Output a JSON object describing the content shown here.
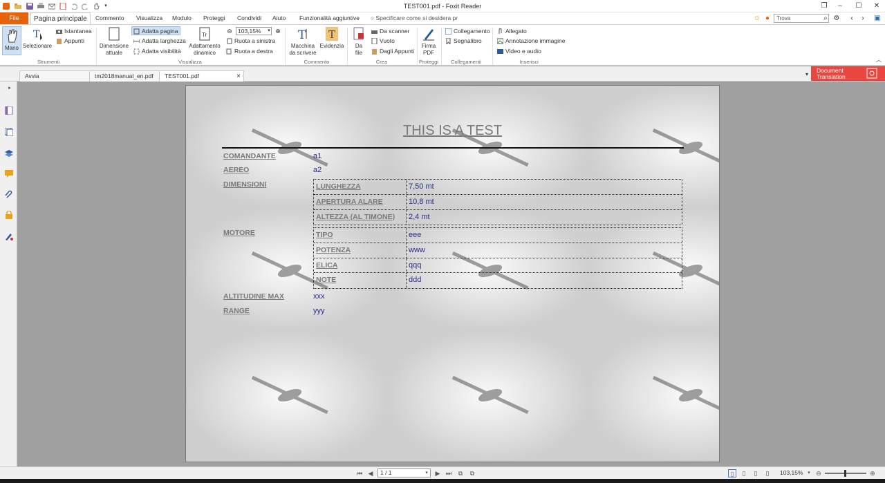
{
  "window": {
    "title": "TEST001.pdf - Foxit Reader"
  },
  "menu": {
    "file": "File",
    "tabs": [
      "Pagina principale",
      "Commento",
      "Visualizza",
      "Modulo",
      "Proteggi",
      "Condividi",
      "Aiuto",
      "Funzionalità aggiuntive"
    ],
    "tell_me": "Specificare come si desidera pr",
    "search_placeholder": "Trova"
  },
  "ribbon": {
    "strumenti": {
      "label": "Strumenti",
      "mano": "Mano",
      "selezionare": "Selezionare",
      "istantanea": "Istantanea",
      "appunti": "Appunti"
    },
    "visualizza": {
      "label": "Visualizza",
      "dimensione_1": "Dimensione",
      "dimensione_2": "attuale",
      "adatta_pagina": "Adatta pagina",
      "adatta_larghezza": "Adatta larghezza",
      "adatta_visibilita": "Adatta visibilità",
      "adattamento_1": "Adattamento",
      "adattamento_2": "dinamico",
      "zoom": "103,15%",
      "ruota_sinistra": "Ruota a sinistra",
      "ruota_destra": "Ruota a destra"
    },
    "commento": {
      "label": "Commento",
      "macchina_1": "Macchina",
      "macchina_2": "da scrivere",
      "evidenzia": "Evidenzia"
    },
    "crea": {
      "label": "Crea",
      "da_file_1": "Da",
      "da_file_2": "file",
      "da_scanner": "Da scanner",
      "vuoto": "Vuoto",
      "dagli_appunti": "Dagli Appunti"
    },
    "proteggi": {
      "label": "Proteggi",
      "firma_1": "Firma",
      "firma_2": "PDF"
    },
    "collegamenti": {
      "label": "Collegamenti",
      "collegamento": "Collegamento",
      "segnalibro": "Segnalibro"
    },
    "inserisci": {
      "label": "Inserisci",
      "allegato": "Allegato",
      "annotazione": "Annotazione immagine",
      "video": "Video e audio"
    }
  },
  "doc_tabs": [
    "Avvia",
    "tm2018manual_en.pdf",
    "TEST001.pdf"
  ],
  "doc_translation": {
    "line1": "Document",
    "line2": "Translation"
  },
  "document": {
    "title": "THIS IS A TEST",
    "comandante": {
      "label": "COMANDANTE",
      "value": "a1"
    },
    "aereo": {
      "label": "AEREO",
      "value": "a2"
    },
    "dimensioni": {
      "label": "DIMENSIONI",
      "rows": [
        {
          "k": "LUNGHEZZA",
          "v": "7,50 mt"
        },
        {
          "k": "APERTURA ALARE",
          "v": "10,8 mt"
        },
        {
          "k": "ALTEZZA (AL TIMONE)",
          "v": "2,4 mt"
        }
      ]
    },
    "motore": {
      "label": "MOTORE",
      "rows": [
        {
          "k": "TIPO",
          "v": "eee"
        },
        {
          "k": "POTENZA",
          "v": "www"
        },
        {
          "k": "ELICA",
          "v": "qqq"
        },
        {
          "k": "NOTE",
          "v": "ddd"
        }
      ]
    },
    "altitudine": {
      "label": "ALTITUDINE MAX",
      "value": "xxx"
    },
    "range": {
      "label": "RANGE",
      "value": "yyy"
    }
  },
  "status": {
    "page": "1 / 1",
    "zoom": "103,15%"
  }
}
